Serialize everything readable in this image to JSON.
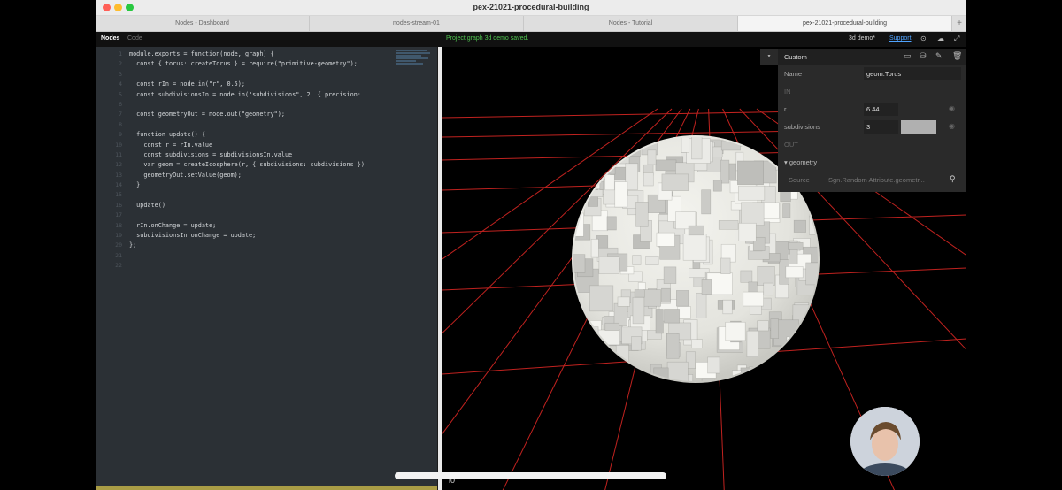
{
  "window": {
    "title": "pex-21021-procedural-building",
    "tabs": [
      {
        "label": "Nodes - Dashboard",
        "active": false
      },
      {
        "label": "nodes-stream-01",
        "active": false
      },
      {
        "label": "Nodes - Tutorial",
        "active": false
      },
      {
        "label": "pex-21021-procedural-building",
        "active": true
      }
    ],
    "add_tab_label": "+"
  },
  "toolbar": {
    "nodes_label": "Nodes",
    "code_label": "Code",
    "status": "Project graph 3d demo saved.",
    "project_label": "3d demo*",
    "support_label": "Support"
  },
  "editor": {
    "line_numbers": [
      "1",
      "2",
      "3",
      "4",
      "5",
      "6",
      "7",
      "8",
      "9",
      "10",
      "11",
      "12",
      "13",
      "14",
      "15",
      "16",
      "17",
      "18",
      "19",
      "20",
      "21",
      "22"
    ],
    "lines": [
      "module.exports = function(node, graph) {",
      "  const { torus: createTorus } = require(\"primitive-geometry\");",
      "",
      "  const rIn = node.in(\"r\", 0.5);",
      "  const subdivisionsIn = node.in(\"subdivisions\", 2, { precision:",
      "",
      "  const geometryOut = node.out(\"geometry\");",
      "",
      "  function update() {",
      "    const r = rIn.value",
      "    const subdivisions = subdivisionsIn.value",
      "    var geom = createIcosphere(r, { subdivisions: subdivisions })",
      "    geometryOut.setValue(geom);",
      "  }",
      "",
      "  update()",
      "",
      "  rIn.onChange = update;",
      "  subdivisionsIn.onChange = update;",
      "};",
      "",
      ""
    ]
  },
  "inspector": {
    "title": "Custom",
    "name_label": "Name",
    "name_value": "geom.Torus",
    "in_label": "IN",
    "r_label": "r",
    "r_value": "6.44",
    "subdivisions_label": "subdivisions",
    "subdivisions_value": "3",
    "out_label": "OUT",
    "geometry_label": "▾ geometry",
    "source_label": "Source",
    "source_value": "Sgn.Random Attribute.geometr..."
  },
  "viewport": {
    "corner_label": "l0"
  },
  "colors": {
    "grid": "#c0221f",
    "status_green": "#4ec24e",
    "link_blue": "#4fa3ff"
  }
}
